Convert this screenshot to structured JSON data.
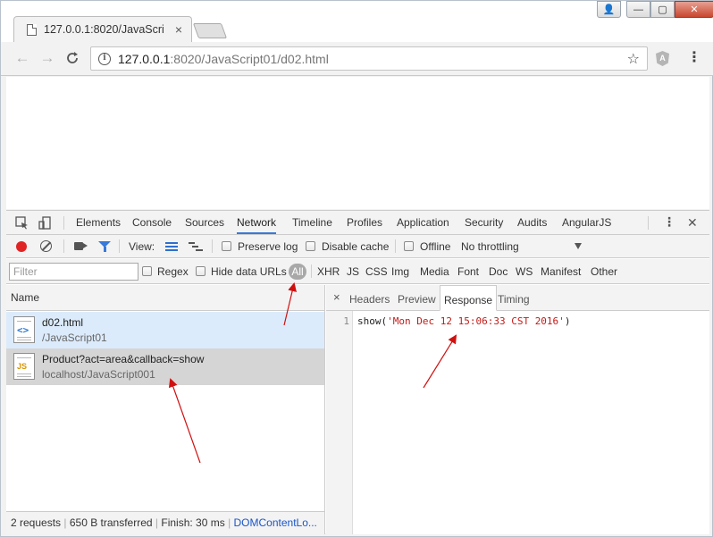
{
  "browser": {
    "tab_title": "127.0.0.1:8020/JavaScri",
    "tab_close": "×",
    "url_host": "127.0.0.1",
    "url_rest": ":8020/JavaScript01/d02.html",
    "info_glyph": "i",
    "star_glyph": "☆",
    "ext_glyph": "A",
    "menu_glyph": "⋮",
    "back_glyph": "←",
    "fwd_glyph": "→",
    "reload_glyph": "C",
    "win_user": "👤",
    "win_min": "—",
    "win_max": "▢",
    "win_close": "✕"
  },
  "devtools": {
    "tabs": [
      "Elements",
      "Console",
      "Sources",
      "Network",
      "Timeline",
      "Profiles",
      "Application",
      "Security",
      "Audits",
      "AngularJS"
    ],
    "active_tab": "Network",
    "more_glyph": "⋮",
    "close_glyph": "✕",
    "toolbar": {
      "view_label": "View:",
      "preserve_log": "Preserve log",
      "disable_cache": "Disable cache",
      "offline": "Offline",
      "throttling": "No throttling"
    },
    "filter_bar": {
      "placeholder": "Filter",
      "regex": "Regex",
      "hide_data_urls": "Hide data URLs",
      "all": "All",
      "types": [
        "XHR",
        "JS",
        "CSS",
        "Img",
        "Media",
        "Font",
        "Doc",
        "WS",
        "Manifest",
        "Other"
      ]
    },
    "requests": {
      "column_name": "Name",
      "rows": [
        {
          "name": "d02.html",
          "path": "/JavaScript01",
          "icon": "html-file-icon"
        },
        {
          "name": "Product?act=area&callback=show",
          "path": "localhost/JavaScript001",
          "icon": "js-file-icon"
        }
      ]
    },
    "status": {
      "requests": "2 requests",
      "transferred": "650 B transferred",
      "finish": "Finish: 30 ms",
      "dcl": "DOMContentLo..."
    },
    "detail": {
      "close_glyph": "×",
      "tabs": [
        "Headers",
        "Preview",
        "Response",
        "Timing"
      ],
      "active_tab": "Response",
      "line_number": "1",
      "code_prefix": "show(",
      "code_string": "'Mon Dec 12 15:06:33 CST 2016'",
      "code_suffix": ")"
    }
  },
  "colors": {
    "accent": "#3879d9",
    "record": "#e02424",
    "arrow": "#d01010",
    "string": "#c41a16"
  }
}
